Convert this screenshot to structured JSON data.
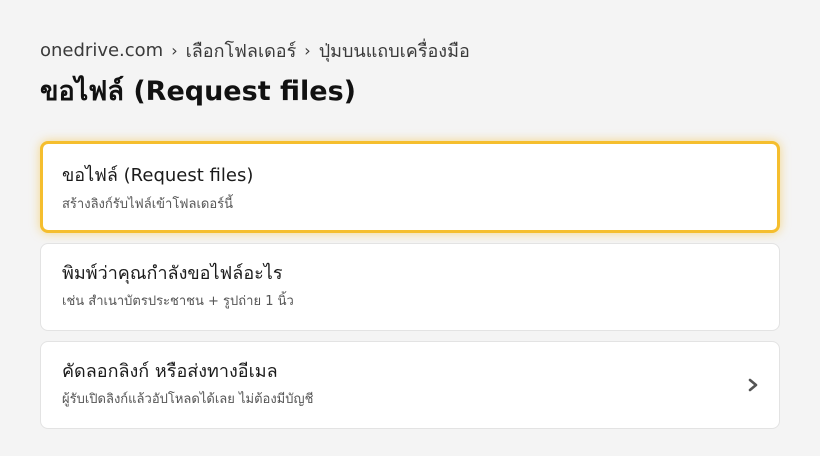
{
  "breadcrumb": {
    "site": "onedrive.com",
    "step1": "เลือกโฟลเดอร์",
    "step2": "ปุ่มบนแถบเครื่องมือ",
    "separator": "›"
  },
  "page": {
    "title": "ขอไฟล์ (Request files)"
  },
  "steps": [
    {
      "title": "ขอไฟล์ (Request files)",
      "description": "สร้างลิงก์รับไฟล์เข้าโฟลเดอร์นี้",
      "active": true
    },
    {
      "title": "พิมพ์ว่าคุณกำลังขอไฟล์อะไร",
      "description": "เช่น สำเนาบัตรประชาชน + รูปถ่าย 1 นิ้ว",
      "active": false
    },
    {
      "title": "คัดลอกลิงก์ หรือส่งทางอีเมล",
      "description": "ผู้รับเปิดลิงก์แล้วอัปโหลดได้เลย ไม่ต้องมีบัญชี",
      "active": false,
      "icon": "chevron-right-icon"
    }
  ],
  "colors": {
    "background": "#f4f4f4",
    "card": "#ffffff",
    "highlight_border": "#f5be2e",
    "text": "#1b1b1b"
  }
}
